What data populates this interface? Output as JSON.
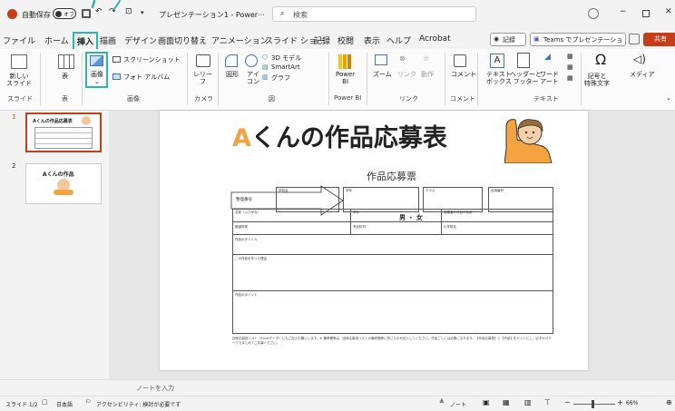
{
  "titlebar": {
    "autosave_label": "自動保存",
    "autosave_state": "オフ",
    "doc_title": "プレゼンテーション1 - Power···",
    "search_placeholder": "検索"
  },
  "tabs": [
    "ファイル",
    "ホーム",
    "挿入",
    "描画",
    "デザイン",
    "画面切り替え",
    "アニメーション",
    "スライド ショー",
    "記録",
    "校閲",
    "表示",
    "ヘルプ",
    "Acrobat"
  ],
  "active_tab": "挿入",
  "right_buttons": {
    "record": "記録",
    "teams": "Teams でプレゼンテーション",
    "share": "共有"
  },
  "ribbon": {
    "new_slide": "新しい\nスライド",
    "table": "表",
    "image": "画像",
    "screenshot": "スクリーンショット",
    "photo_album": "フォト アルバム",
    "camera": "レリー\nフ",
    "shapes": "図形",
    "icons": "アイ\nコン",
    "3d_models": "3D モデル",
    "smartart": "SmartArt",
    "chart": "グラフ",
    "powerbi": "Power\nBI",
    "zoom": "ズーム",
    "link": "リンク",
    "action": "動作",
    "comment": "コメント",
    "textbox": "テキスト\nボックス",
    "header_footer": "ヘッダーと\nフッター",
    "wordart": "ワード\nアート",
    "symbols": "記号と\n特殊文字",
    "media": "メディア",
    "groups": [
      "スライド",
      "表",
      "画像",
      "カメラ",
      "図",
      "Power BI",
      "リンク",
      "コメント",
      "テキスト"
    ]
  },
  "thumbnails": [
    {
      "num": "1",
      "title": "Aくんの作品応募表"
    },
    {
      "num": "2",
      "title": "Aくんの作品"
    }
  ],
  "slide": {
    "title_a": "A",
    "title_rest": "くんの作品応募表",
    "subtitle": "作品応募票",
    "arrow_label": "整理番号",
    "labels": {
      "name_kana": "名前（ふりがな）",
      "grade": "学年",
      "gender": "男 ・ 女",
      "guardian": "保護者の氏名の名前",
      "school_name": "都道府県",
      "city": "市区町村",
      "school": "小学校名",
      "work_title": "作品のタイトル",
      "reason": "この作品を作った理由",
      "point": "作品のポイント",
      "box1": "学校名",
      "box2": "学年",
      "box3": "クラス",
      "box4": "出席番号"
    },
    "footer": "団体応募用リスト（Excelデータ）にもご記入お願いします。※ 備考欄等は、団体応募用リストの備考欄等に同じものを記入してください。作品ごとには必要になります。【作品応募表】と【作品】をセットにし、必ずセロテープでまとめてご応募ください。"
  },
  "notes_label": "ノートを入力",
  "status": {
    "slide_info": "スライド 1/2",
    "language": "日本語",
    "accessibility": "アクセシビリティ: 検討が必要です",
    "notes_btn": "ノート",
    "zoom": "66%"
  },
  "colors": {
    "accent": "#c43e1c",
    "title_orange": "#f4a340",
    "teal_arrow": "#2bb7a7"
  }
}
